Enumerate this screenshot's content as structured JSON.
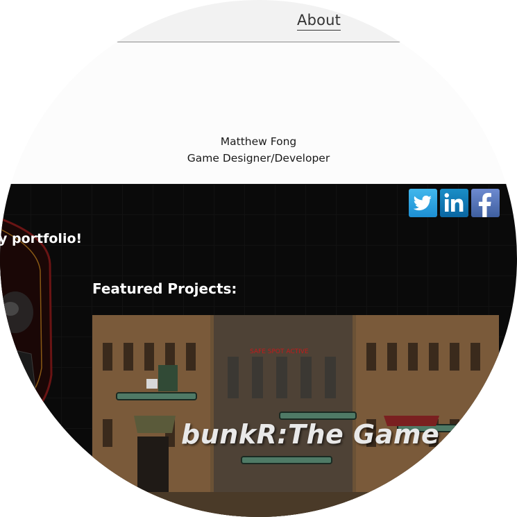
{
  "nav": {
    "about_label": "About"
  },
  "header": {
    "name": "Matthew Fong",
    "role": "Game Designer/Developer"
  },
  "social": {
    "icons": [
      "twitter-icon",
      "linkedin-icon",
      "facebook-icon"
    ]
  },
  "main": {
    "welcome_text": "y portfolio!",
    "featured_heading": "Featured Projects:"
  },
  "project": {
    "title": "bunkR:The Game",
    "sign_text": "SAFE SPOT ACTIVE"
  }
}
